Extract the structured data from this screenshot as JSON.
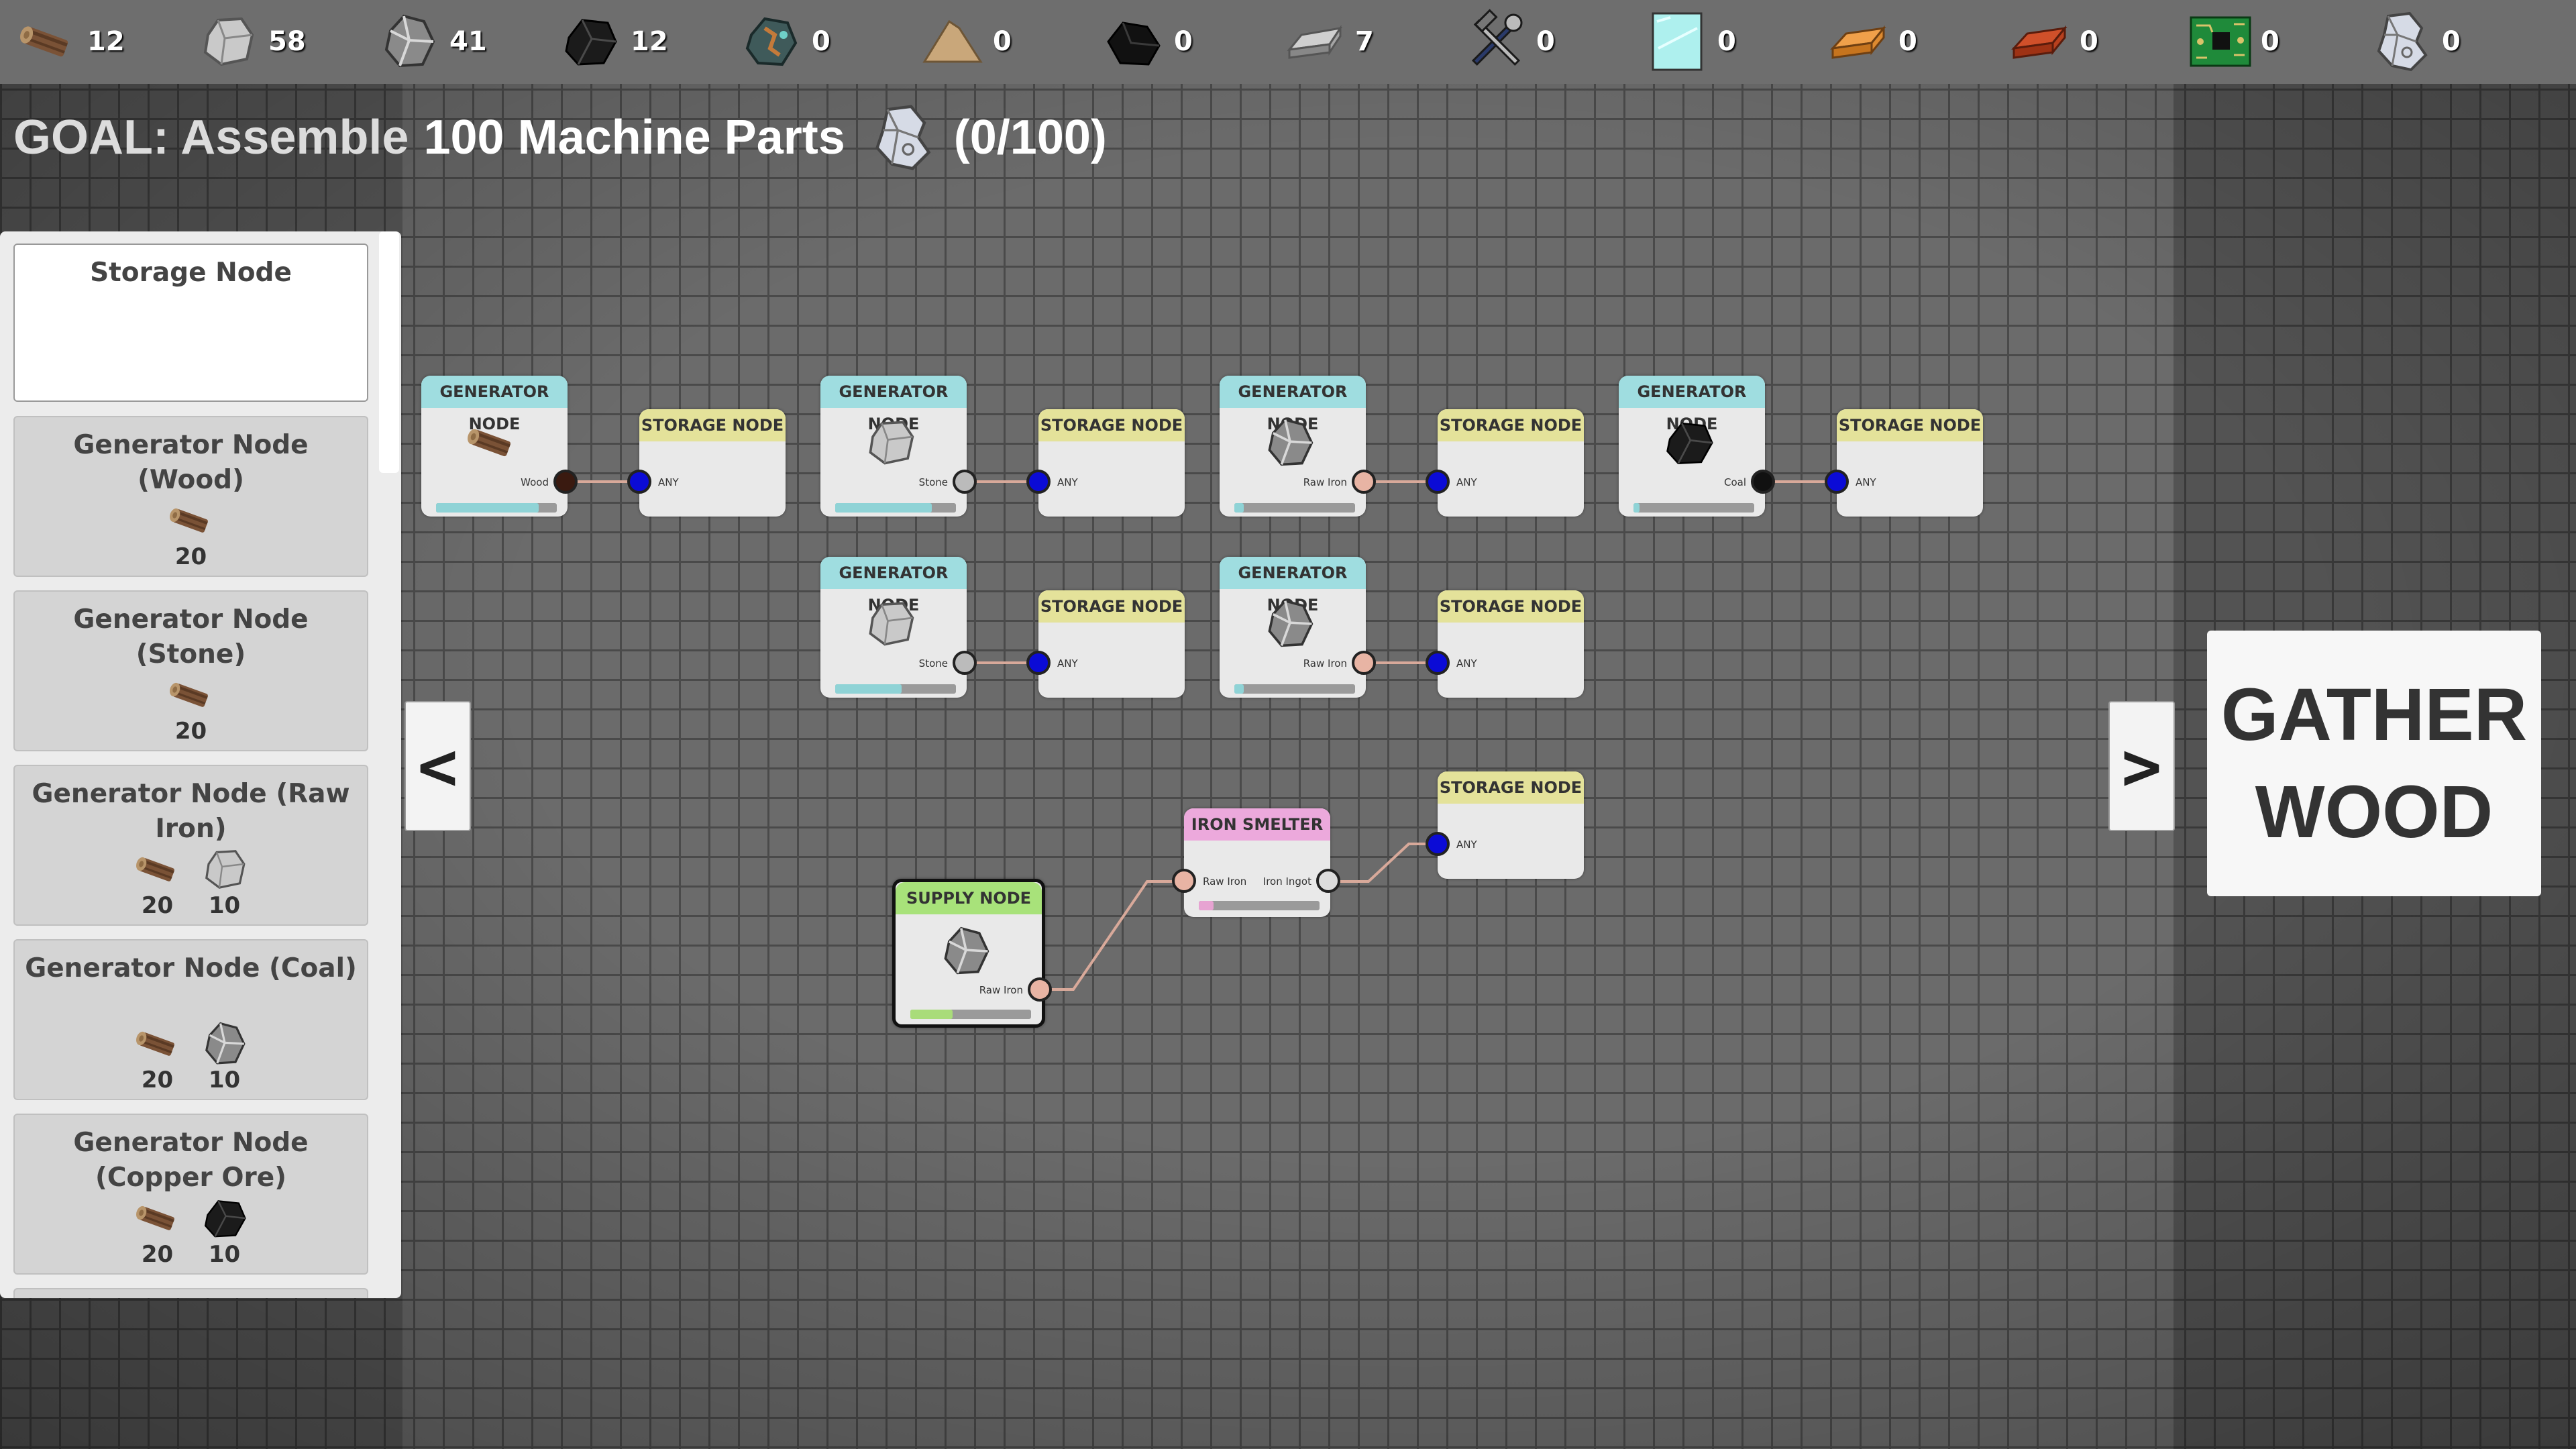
{
  "resources": [
    {
      "icon": "wood-log-icon",
      "count": "12"
    },
    {
      "icon": "stone-icon",
      "count": "58"
    },
    {
      "icon": "raw-iron-icon",
      "count": "41"
    },
    {
      "icon": "coal-icon",
      "count": "12"
    },
    {
      "icon": "copper-ore-icon",
      "count": "0"
    },
    {
      "icon": "sand-pile-icon",
      "count": "0"
    },
    {
      "icon": "dark-ore-icon",
      "count": "0"
    },
    {
      "icon": "iron-ingot-icon",
      "count": "7"
    },
    {
      "icon": "tools-icon",
      "count": "0"
    },
    {
      "icon": "glass-icon",
      "count": "0"
    },
    {
      "icon": "copper-ingot-icon",
      "count": "0"
    },
    {
      "icon": "brick-icon",
      "count": "0"
    },
    {
      "icon": "circuit-board-icon",
      "count": "0"
    },
    {
      "icon": "machine-parts-icon",
      "count": "0"
    }
  ],
  "goal": {
    "prefix": "GOAL: Assemble",
    "target": "100 Machine Parts",
    "progress": "(0/100)"
  },
  "sidebar": {
    "items": [
      {
        "title": "Storage Node",
        "costs": []
      },
      {
        "title": "Generator Node (Wood)",
        "costs": [
          {
            "icon": "wood-log-icon",
            "qty": "20"
          }
        ]
      },
      {
        "title": "Generator Node (Stone)",
        "costs": [
          {
            "icon": "wood-log-icon",
            "qty": "20"
          }
        ]
      },
      {
        "title": "Generator Node (Raw Iron)",
        "costs": [
          {
            "icon": "wood-log-icon",
            "qty": "20"
          },
          {
            "icon": "stone-icon",
            "qty": "10"
          }
        ]
      },
      {
        "title": "Generator Node (Coal)",
        "costs": [
          {
            "icon": "wood-log-icon",
            "qty": "20"
          },
          {
            "icon": "raw-iron-icon",
            "qty": "10"
          }
        ]
      },
      {
        "title": "Generator Node (Copper Ore)",
        "costs": [
          {
            "icon": "wood-log-icon",
            "qty": "20"
          },
          {
            "icon": "coal-icon",
            "qty": "10"
          }
        ]
      }
    ]
  },
  "nav": {
    "prev": "<",
    "next": ">"
  },
  "action": {
    "label_line1": "GATHER",
    "label_line2": "WOOD"
  },
  "labels": {
    "generator": "GENERATOR NODE",
    "storage": "STORAGE NODE",
    "supply": "SUPPLY NODE",
    "smelter": "IRON SMELTER",
    "any": "ANY",
    "wood": "Wood",
    "stone": "Stone",
    "raw_iron": "Raw Iron",
    "coal": "Coal",
    "iron_ingot": "Iron Ingot"
  },
  "colors": {
    "generator": "#9fdde0",
    "storage": "#e4e29a",
    "supply": "#a8e27a",
    "smelter": "#eca9dc",
    "input_port": "#0b0bd6"
  },
  "nodes": {
    "gen1": {
      "progress": 0.85
    },
    "gen2": {
      "progress": 0.8
    },
    "gen3": {
      "progress": 0.08
    },
    "gen4": {
      "progress": 0.05
    },
    "gen5": {
      "progress": 0.55
    },
    "gen6": {
      "progress": 0.08
    },
    "supply": {
      "progress": 0.35
    },
    "smelter": {
      "progress": 0.12
    }
  }
}
